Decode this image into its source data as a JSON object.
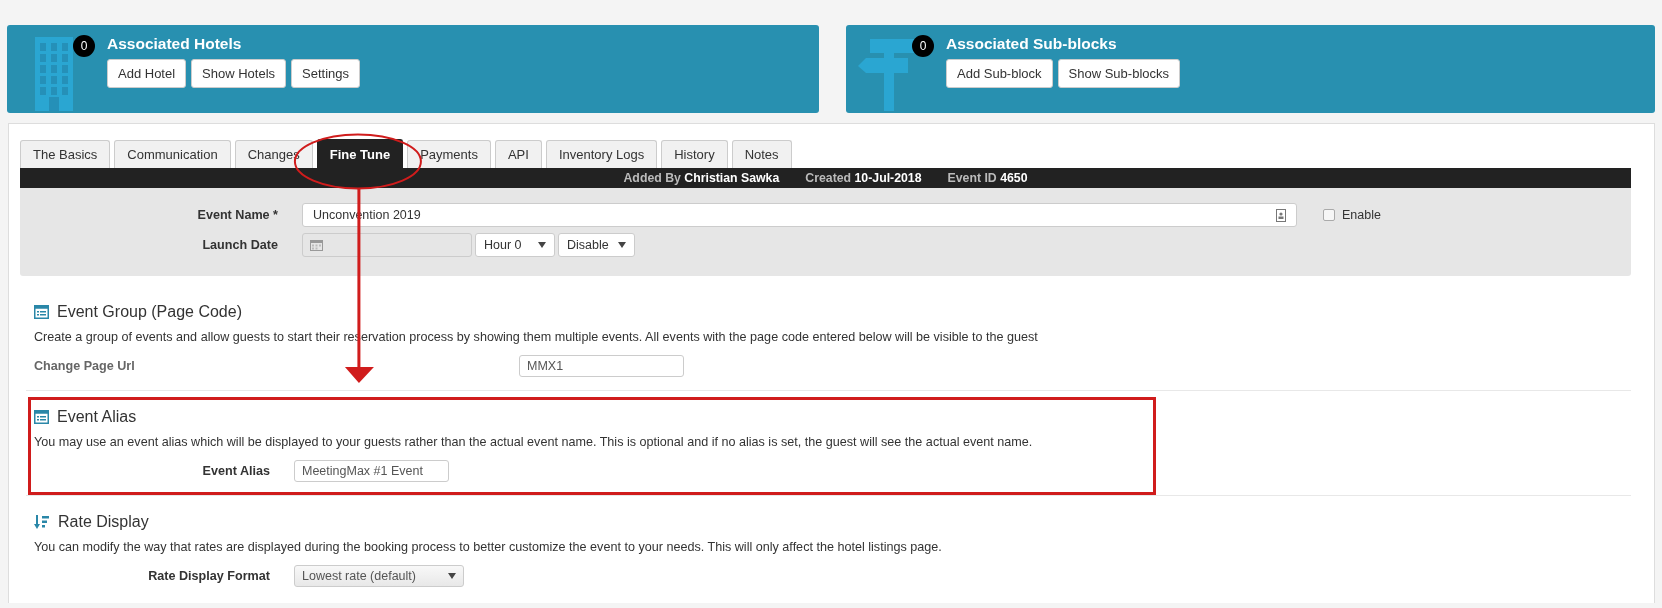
{
  "panels": [
    {
      "kind": "hotels",
      "count": "0",
      "title": "Associated Hotels",
      "buttons": [
        "Add Hotel",
        "Show Hotels",
        "Settings"
      ]
    },
    {
      "kind": "subblocks",
      "count": "0",
      "title": "Associated Sub-blocks",
      "buttons": [
        "Add Sub-block",
        "Show Sub-blocks"
      ]
    }
  ],
  "tabs": [
    {
      "label": "The Basics",
      "selected": false,
      "circled": false
    },
    {
      "label": "Communication",
      "selected": false,
      "circled": false
    },
    {
      "label": "Changes",
      "selected": false,
      "circled": false
    },
    {
      "label": "Fine Tune",
      "selected": true,
      "circled": true
    },
    {
      "label": "Payments",
      "selected": false,
      "circled": false
    },
    {
      "label": "API",
      "selected": false,
      "circled": false
    },
    {
      "label": "Inventory Logs",
      "selected": false,
      "circled": false
    },
    {
      "label": "History",
      "selected": false,
      "circled": false
    },
    {
      "label": "Notes",
      "selected": false,
      "circled": false
    }
  ],
  "info_bar": [
    {
      "label": "Added By",
      "value": "Christian Sawka"
    },
    {
      "label": "Created",
      "value": "10-Jul-2018"
    },
    {
      "label": "Event ID",
      "value": "4650"
    }
  ],
  "event_form": {
    "event_name": {
      "label": "Event Name *",
      "value": "Unconvention 2019"
    },
    "enable": {
      "label": "Enable",
      "checked": false
    },
    "launch_date": {
      "label": "Launch Date",
      "hour": "Hour 0",
      "mode": "Disable"
    }
  },
  "sections": [
    {
      "kind": "page-code",
      "title": "Event Group (Page Code)",
      "description": "Create a group of events and allow guests to start their reservation process by showing them multiple events. All events with the page code entered below will be visible to the guest",
      "highlighted": false,
      "field": {
        "kind": "text",
        "label": "Change Page Url",
        "value": "MMX1"
      }
    },
    {
      "kind": "alias",
      "title": "Event Alias",
      "description": "You may use an event alias which will be displayed to your guests rather than the actual event name. This is optional and if no alias is set, the guest will see the actual event name.",
      "highlighted": true,
      "field": {
        "kind": "text",
        "label": "Event Alias",
        "value": "MeetingMax #1 Event"
      }
    },
    {
      "kind": "display",
      "title": "Rate Display",
      "description": "You can modify the way that rates are displayed during the booking process to better customize the event to your needs. This will only affect the hotel listings page.",
      "highlighted": false,
      "field": {
        "kind": "select",
        "label": "Rate Display Format",
        "value": "Lowest rate (default)"
      }
    }
  ]
}
